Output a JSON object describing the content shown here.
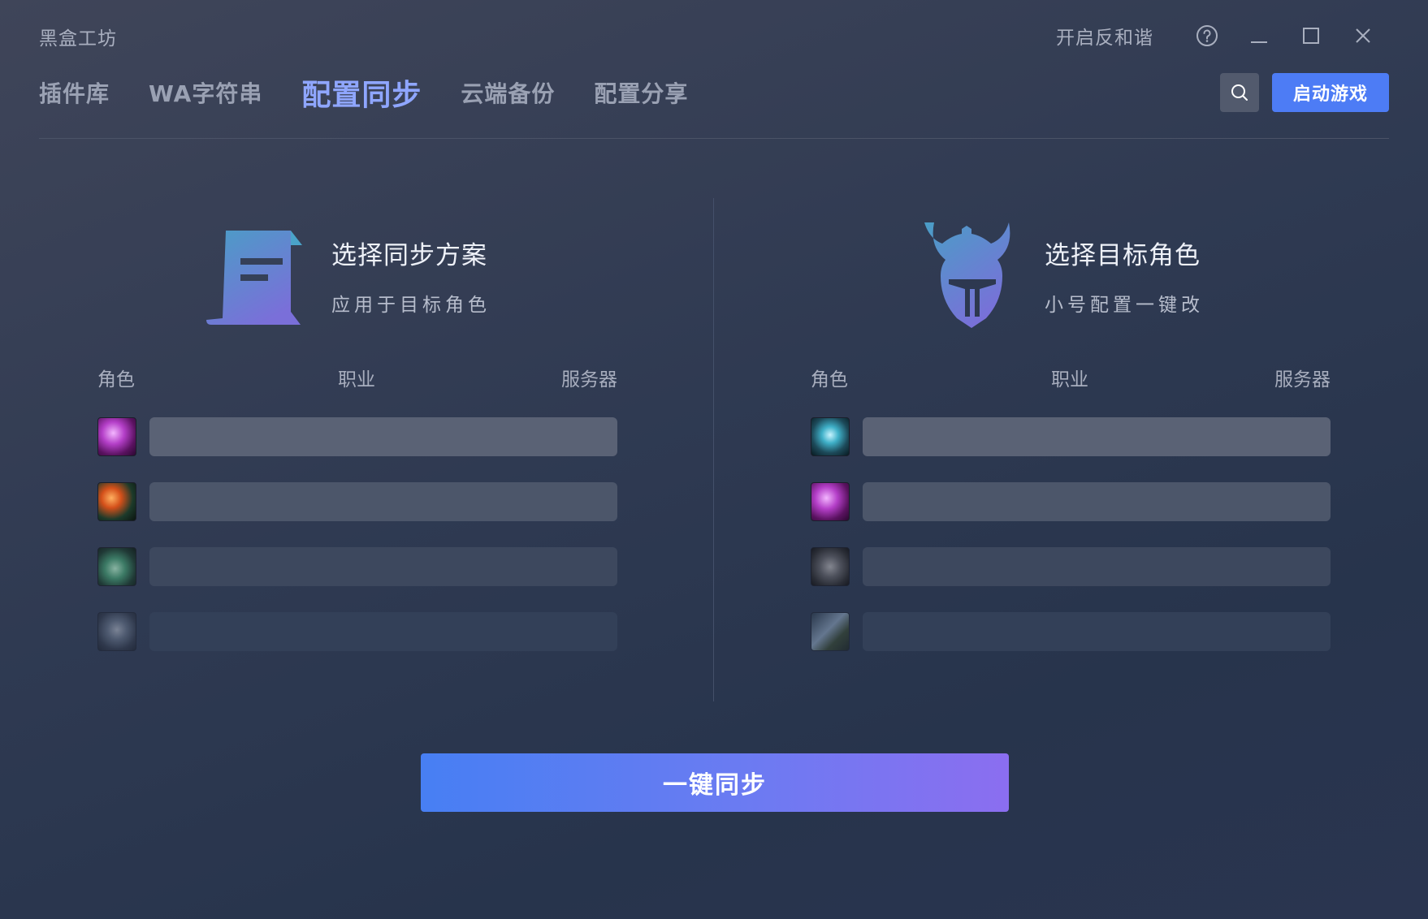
{
  "app": {
    "title": "黑盒工坊"
  },
  "titlebar": {
    "harmony_label": "开启反和谐",
    "help_icon": "help-circle-icon",
    "minimize_icon": "minimize-icon",
    "maximize_icon": "maximize-icon",
    "close_icon": "close-icon"
  },
  "nav": {
    "tabs": [
      {
        "label": "插件库",
        "active": false
      },
      {
        "label": "WA字符串",
        "active": false
      },
      {
        "label": "配置同步",
        "active": true
      },
      {
        "label": "云端备份",
        "active": false
      },
      {
        "label": "配置分享",
        "active": false
      }
    ],
    "search_icon": "search-icon",
    "launch_label": "启动游戏"
  },
  "left_panel": {
    "icon": "scroll-document-icon",
    "title": "选择同步方案",
    "subtitle": "应用于目标角色",
    "columns": [
      "角色",
      "职业",
      "服务器"
    ],
    "rows": [
      {
        "avatar_icon": "shadow-priest-class-icon"
      },
      {
        "avatar_icon": "hunter-bow-class-icon"
      },
      {
        "avatar_icon": "shaman-totem-class-icon"
      },
      {
        "avatar_icon": "warrior-weapon-class-icon"
      }
    ]
  },
  "right_panel": {
    "icon": "horned-helmet-icon",
    "title": "选择目标角色",
    "subtitle": "小号配置一键改",
    "columns": [
      "角色",
      "职业",
      "服务器"
    ],
    "rows": [
      {
        "avatar_icon": "mage-hammer-class-icon"
      },
      {
        "avatar_icon": "shadow-priest-class-icon"
      },
      {
        "avatar_icon": "druid-claw-class-icon"
      },
      {
        "avatar_icon": "warrior-sword-class-icon"
      }
    ]
  },
  "sync_button": {
    "label": "一键同步"
  },
  "colors": {
    "accent": "#4d7cf5",
    "active_tab": "#8fa6ff",
    "gradient_start": "#477ff3",
    "gradient_end": "#8b6ef0"
  }
}
